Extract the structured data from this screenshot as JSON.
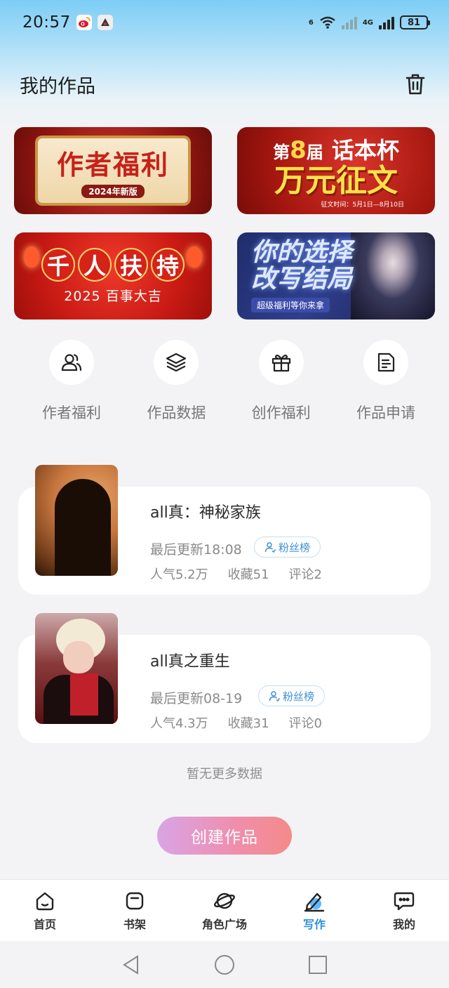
{
  "status_bar": {
    "time": "20:57",
    "app_icons": [
      "weibo-icon",
      "game-app-icon"
    ],
    "wifi_label": "6",
    "network_label": "4G",
    "battery": "81"
  },
  "header": {
    "title": "我的作品",
    "delete_icon": "trash-icon"
  },
  "banners": [
    {
      "id": "author-welfare",
      "main": "作者福利",
      "sub": "2024年新版"
    },
    {
      "id": "essay-contest",
      "edition_prefix": "第",
      "edition_num": "8",
      "edition_suffix": "届",
      "cup": "话本杯",
      "main": "万元征文",
      "date": "征文时间：5月1日—8月10日"
    },
    {
      "id": "support",
      "main": [
        "千",
        "人",
        "扶",
        "持"
      ],
      "sub": "2025 百事大吉"
    },
    {
      "id": "choice",
      "main": "你的选择改写结局",
      "sub": "超级福利等你来拿"
    }
  ],
  "quick_nav": [
    {
      "label": "作者福利",
      "icon": "users-icon"
    },
    {
      "label": "作品数据",
      "icon": "layers-icon"
    },
    {
      "label": "创作福利",
      "icon": "gift-icon"
    },
    {
      "label": "作品申请",
      "icon": "document-icon"
    }
  ],
  "works": [
    {
      "title": "all真：神秘家族",
      "updated": "最后更新18:08",
      "fans_badge": "粉丝榜",
      "popularity": "人气5.2万",
      "favorites": "收藏51",
      "comments": "评论2"
    },
    {
      "title": "all真之重生",
      "updated": "最后更新08-19",
      "fans_badge": "粉丝榜",
      "popularity": "人气4.3万",
      "favorites": "收藏31",
      "comments": "评论0"
    }
  ],
  "no_more": "暂无更多数据",
  "create_button": "创建作品",
  "tabs": [
    {
      "label": "首页",
      "icon": "home-icon",
      "active": false
    },
    {
      "label": "书架",
      "icon": "bookshelf-icon",
      "active": false
    },
    {
      "label": "角色广场",
      "icon": "planet-icon",
      "active": false
    },
    {
      "label": "写作",
      "icon": "write-icon",
      "active": true
    },
    {
      "label": "我的",
      "icon": "chat-icon",
      "active": false
    }
  ],
  "colors": {
    "accent": "#2e8fe0",
    "create_gradient_start": "#d9a4e6",
    "create_gradient_end": "#f48a88",
    "status_bar_top": "#7ccdf6"
  }
}
